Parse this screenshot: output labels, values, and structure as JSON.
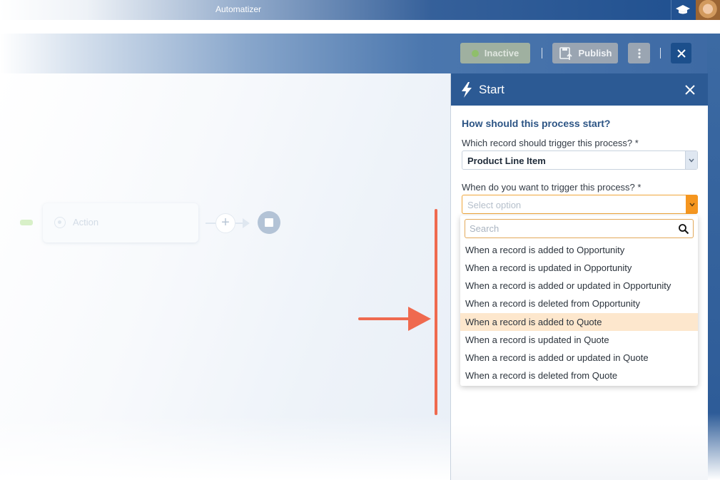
{
  "app": {
    "title": "Automatizer"
  },
  "toolbar": {
    "inactive_label": "Inactive",
    "publish_label": "Publish"
  },
  "canvas": {
    "action_node_label": "Action"
  },
  "panel": {
    "title": "Start",
    "question": "How should this process start?",
    "record_field": {
      "label": "Which record should trigger this process? *",
      "value": "Product Line Item"
    },
    "trigger_field": {
      "label": "When do you want to trigger this process? *",
      "placeholder": "Select option"
    },
    "dropdown": {
      "search_placeholder": "Search",
      "options": [
        "When a record is added to Opportunity",
        "When a record is updated in Opportunity",
        "When a record is added or updated in Opportunity",
        "When a record is deleted from Opportunity",
        "When a record is added to Quote",
        "When a record is updated in Quote",
        "When a record is added or updated in Quote",
        "When a record is deleted from Quote"
      ],
      "highlighted_option": "When a record is added to Quote"
    }
  },
  "colors": {
    "accent": "#2c5a94",
    "focus_orange": "#f5961f",
    "highlight": "#fde7cd",
    "annotation": "#ef6a4f"
  },
  "icons": {
    "topbar": [
      "graduation-cap-icon",
      "user-avatar"
    ],
    "toolbar": [
      "status-dot-icon",
      "publish-icon",
      "more-vertical-icon",
      "close-icon"
    ],
    "panel": [
      "lightning-icon",
      "close-icon",
      "chevron-down-icon",
      "search-icon"
    ],
    "annotation": [
      "arrow-right-icon"
    ]
  }
}
